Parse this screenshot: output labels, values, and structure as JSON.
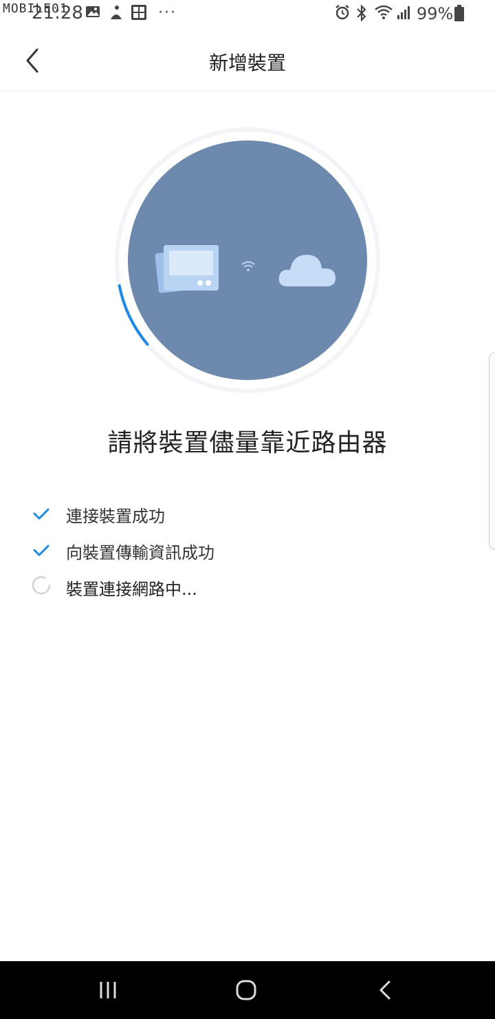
{
  "status_bar": {
    "watermark": "MOBILE01",
    "time": "21:28",
    "overflow": "···",
    "battery": "99%",
    "icons": [
      "gallery-icon",
      "app-icon",
      "calculator-icon",
      "alarm-icon",
      "bluetooth-icon",
      "wifi-icon",
      "signal-icon",
      "battery-icon"
    ]
  },
  "header": {
    "title": "新增裝置",
    "back_icon": "chevron-left-icon"
  },
  "illustration": {
    "progress": 0.08,
    "colors": {
      "circle": "#6d89ad",
      "accent": "#1e88e5",
      "device": "#b9d3f3",
      "cloud": "#c7dcf6"
    }
  },
  "main": {
    "heading": "請將裝置儘量靠近路由器",
    "steps": [
      {
        "label": "連接裝置成功",
        "status": "done"
      },
      {
        "label": "向裝置傳輸資訊成功",
        "status": "done"
      },
      {
        "label": "裝置連接網路中...",
        "status": "loading"
      }
    ]
  },
  "nav_bar": {
    "buttons": [
      "recent-apps-icon",
      "home-icon",
      "back-icon"
    ]
  }
}
